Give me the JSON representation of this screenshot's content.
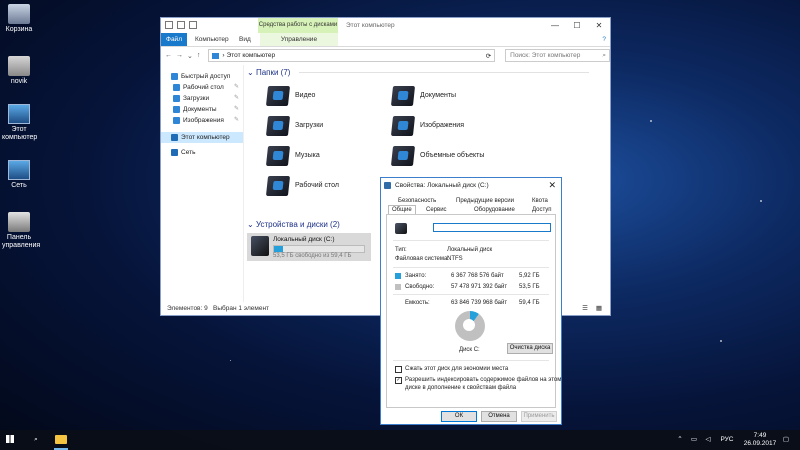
{
  "desktop_icons": [
    {
      "label": "Корзина"
    },
    {
      "label": "novik"
    },
    {
      "label": "Этот компьютер"
    },
    {
      "label": "Сеть"
    },
    {
      "label": "Панель управления"
    }
  ],
  "explorer": {
    "context_tab": "Средства работы с дисками",
    "title": "Этот компьютер",
    "ribbon_tabs": [
      "Файл",
      "Компьютер",
      "Вид",
      "Управление"
    ],
    "address": "Этот компьютер",
    "search_placeholder": "Поиск: Этот компьютер",
    "nav": [
      {
        "label": "Быстрый доступ",
        "top": true,
        "color": "#2f86d6"
      },
      {
        "label": "Рабочий стол",
        "top": false,
        "color": "#2f86d6",
        "pinned": true
      },
      {
        "label": "Загрузки",
        "top": false,
        "color": "#2f86d6",
        "pinned": true
      },
      {
        "label": "Документы",
        "top": false,
        "color": "#2f86d6",
        "pinned": true
      },
      {
        "label": "Изображения",
        "top": false,
        "color": "#2f86d6",
        "pinned": true
      },
      {
        "label": "Этот компьютер",
        "top": true,
        "color": "#1f6bb5",
        "selected": true
      },
      {
        "label": "Сеть",
        "top": true,
        "color": "#1f6bb5"
      }
    ],
    "folders_header": "Папки (7)",
    "folders": [
      "Видео",
      "Документы",
      "Загрузки",
      "Изображения",
      "Музыка",
      "Объемные объекты",
      "Рабочий стол"
    ],
    "devices_header": "Устройства и диски (2)",
    "drive": {
      "name": "Локальный диск (C:)",
      "free_text": "53,5 ГБ свободно из 59,4 ГБ",
      "used_fraction": 0.1
    },
    "status_items": "Элементов: 9",
    "status_selected": "Выбран 1 элемент"
  },
  "properties": {
    "title": "Свойства: Локальный диск (C:)",
    "tabs_row1": [
      "Безопасность",
      "Предыдущие версии",
      "Квота"
    ],
    "tabs_row2": [
      "Общие",
      "Сервис",
      "Оборудование",
      "Доступ"
    ],
    "type_label": "Тип:",
    "type_value": "Локальный диск",
    "fs_label": "Файловая система:",
    "fs_value": "NTFS",
    "used_label": "Занято:",
    "used_bytes": "6 367 768 576 байт",
    "used_gb": "5,92 ГБ",
    "free_label": "Свободно:",
    "free_bytes": "57 478 971 392 байт",
    "free_gb": "53,5 ГБ",
    "cap_label": "Емкость:",
    "cap_bytes": "63 846 739 968 байт",
    "cap_gb": "59,4 ГБ",
    "used_color": "#26a0da",
    "free_color": "#c0c0c0",
    "disk_label": "Диск C:",
    "cleanup_button": "Очистка диска",
    "compress_label": "Сжать этот диск для экономии места",
    "compress_checked": false,
    "index_label_1": "Разрешить индексировать содержимое файлов на этом",
    "index_label_2": "диске в дополнение к свойствам файла",
    "index_checked": true,
    "ok": "ОК",
    "cancel": "Отмена",
    "apply": "Применить"
  },
  "taskbar": {
    "lang": "РУС",
    "time": "7:49",
    "date": "26.09.2017"
  }
}
